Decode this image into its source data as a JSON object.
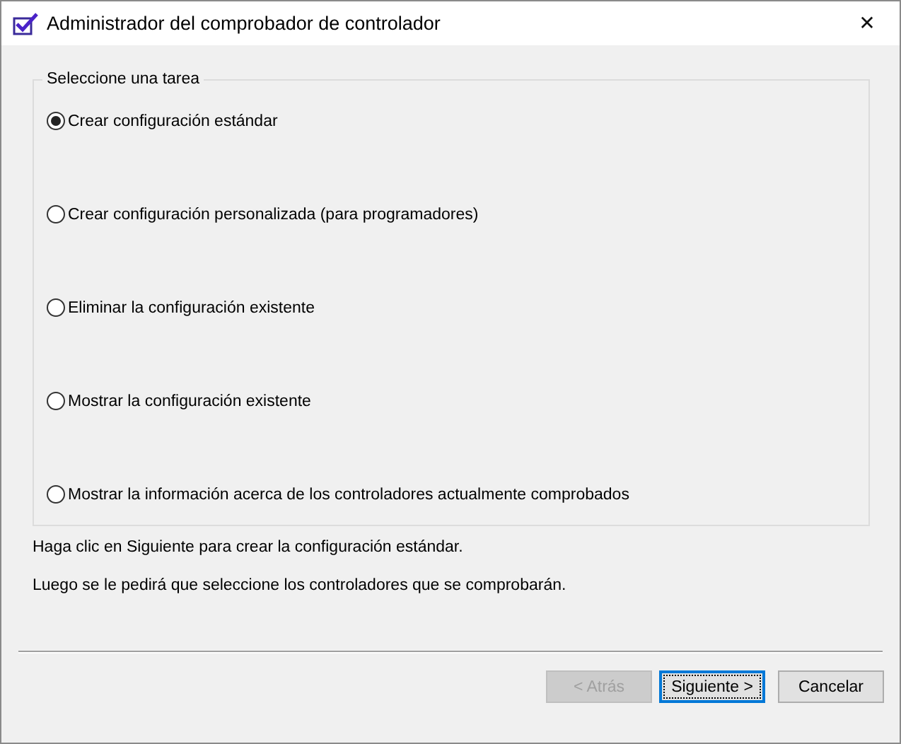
{
  "window": {
    "title": "Administrador del comprobador de controlador",
    "close": "✕"
  },
  "group": {
    "title": "Seleccione una tarea",
    "options": [
      {
        "label": "Crear configuración estándar",
        "selected": true
      },
      {
        "label": "Crear configuración personalizada (para programadores)",
        "selected": false
      },
      {
        "label": "Eliminar la configuración existente",
        "selected": false
      },
      {
        "label": "Mostrar la configuración existente",
        "selected": false
      },
      {
        "label": "Mostrar la información acerca de los controladores actualmente comprobados",
        "selected": false
      }
    ]
  },
  "info": [
    "Haga clic en Siguiente para crear la configuración estándar.",
    "Luego se le pedirá que seleccione los controladores que se comprobarán."
  ],
  "buttons": [
    {
      "label": "< Atrás",
      "disabled": true,
      "default": false
    },
    {
      "label": "Siguiente >",
      "disabled": false,
      "default": true
    },
    {
      "label": "Cancelar",
      "disabled": false,
      "default": false
    }
  ]
}
